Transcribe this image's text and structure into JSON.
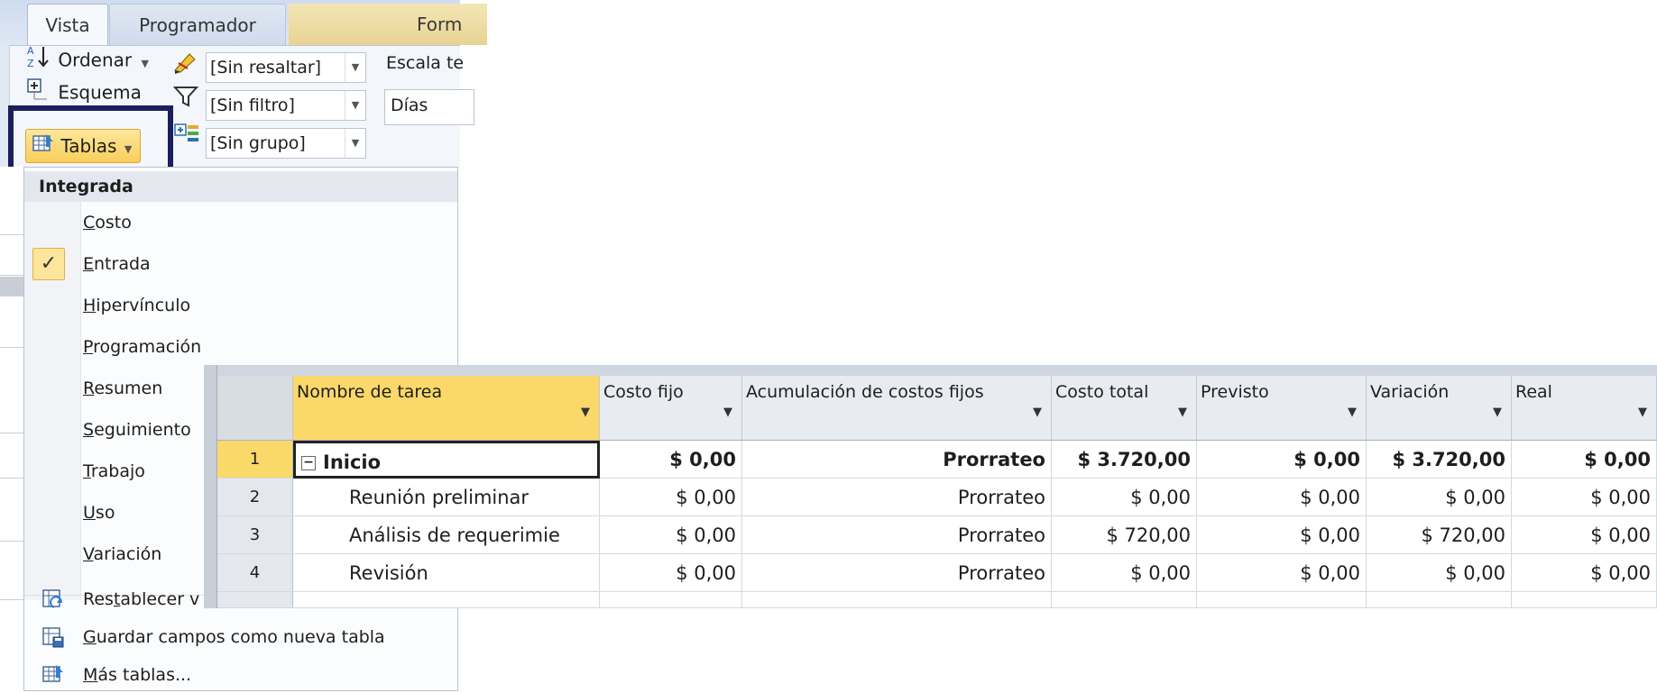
{
  "ribbon": {
    "tabs": [
      {
        "label": "Vista"
      },
      {
        "label": "Programador"
      },
      {
        "label": "Form"
      }
    ],
    "sort_label": "Ordenar",
    "outline_label": "Esquema",
    "tables_label": "Tablas",
    "highlight_value": "[Sin resaltar]",
    "filter_value": "[Sin filtro]",
    "group_value": "[Sin grupo]",
    "timescale_label": "Escala te",
    "timescale_value": "Días"
  },
  "menu": {
    "header": "Integrada",
    "items": [
      {
        "label": "Costo",
        "accel": "C",
        "rest": "osto",
        "checked": false
      },
      {
        "label": "Entrada",
        "accel": "E",
        "rest": "ntrada",
        "checked": true
      },
      {
        "label": "Hipervínculo",
        "accel": "H",
        "rest": "ipervínculo",
        "checked": false
      },
      {
        "label": "Programación",
        "accel": "P",
        "rest": "rogramación",
        "checked": false
      },
      {
        "label": "Resumen",
        "accel": "R",
        "rest": "esumen",
        "checked": false
      },
      {
        "label": "Seguimiento",
        "accel": "S",
        "rest": "eguimiento",
        "checked": false
      },
      {
        "label": "Trabajo",
        "accel": "T",
        "rest": "rabajo",
        "checked": false
      },
      {
        "label": "Uso",
        "accel": "U",
        "rest": "so",
        "checked": false
      },
      {
        "label": "Variación",
        "accel": "V",
        "rest": "ariación",
        "checked": false
      }
    ],
    "check_glyph": "✓",
    "actions": [
      {
        "pre": "Res",
        "accel": "t",
        "post": "ablecer v"
      },
      {
        "pre": "",
        "accel": "G",
        "post": "uardar campos como nueva tabla"
      },
      {
        "pre": "",
        "accel": "M",
        "post": "ás tablas..."
      }
    ]
  },
  "table": {
    "columns": [
      {
        "label": "Nombre de tarea"
      },
      {
        "label": "Costo fijo"
      },
      {
        "label": "Acumulación de costos fijos"
      },
      {
        "label": "Costo total"
      },
      {
        "label": "Previsto"
      },
      {
        "label": "Variación"
      },
      {
        "label": "Real"
      }
    ],
    "rows": [
      {
        "id": "1",
        "name": "Inicio",
        "costo_fijo": "$ 0,00",
        "acumulacion": "Prorrateo",
        "costo_total": "$ 3.720,00",
        "previsto": "$ 0,00",
        "variacion": "$ 3.720,00",
        "real": "$ 0,00"
      },
      {
        "id": "2",
        "name": "Reunión preliminar",
        "costo_fijo": "$ 0,00",
        "acumulacion": "Prorrateo",
        "costo_total": "$ 0,00",
        "previsto": "$ 0,00",
        "variacion": "$ 0,00",
        "real": "$ 0,00"
      },
      {
        "id": "3",
        "name": "Análisis de requerimie",
        "costo_fijo": "$ 0,00",
        "acumulacion": "Prorrateo",
        "costo_total": "$ 720,00",
        "previsto": "$ 0,00",
        "variacion": "$ 720,00",
        "real": "$ 0,00"
      },
      {
        "id": "4",
        "name": "Revisión",
        "costo_fijo": "$ 0,00",
        "acumulacion": "Prorrateo",
        "costo_total": "$ 0,00",
        "previsto": "$ 0,00",
        "variacion": "$ 0,00",
        "real": "$ 0,00"
      }
    ],
    "collapse_glyph": "−",
    "dropdown_glyph": "▼"
  },
  "colors": {
    "highlight_frame": "#1b1f5e",
    "selected_header": "#fbd86a",
    "ribbon_bg": "#f3f6fa"
  }
}
